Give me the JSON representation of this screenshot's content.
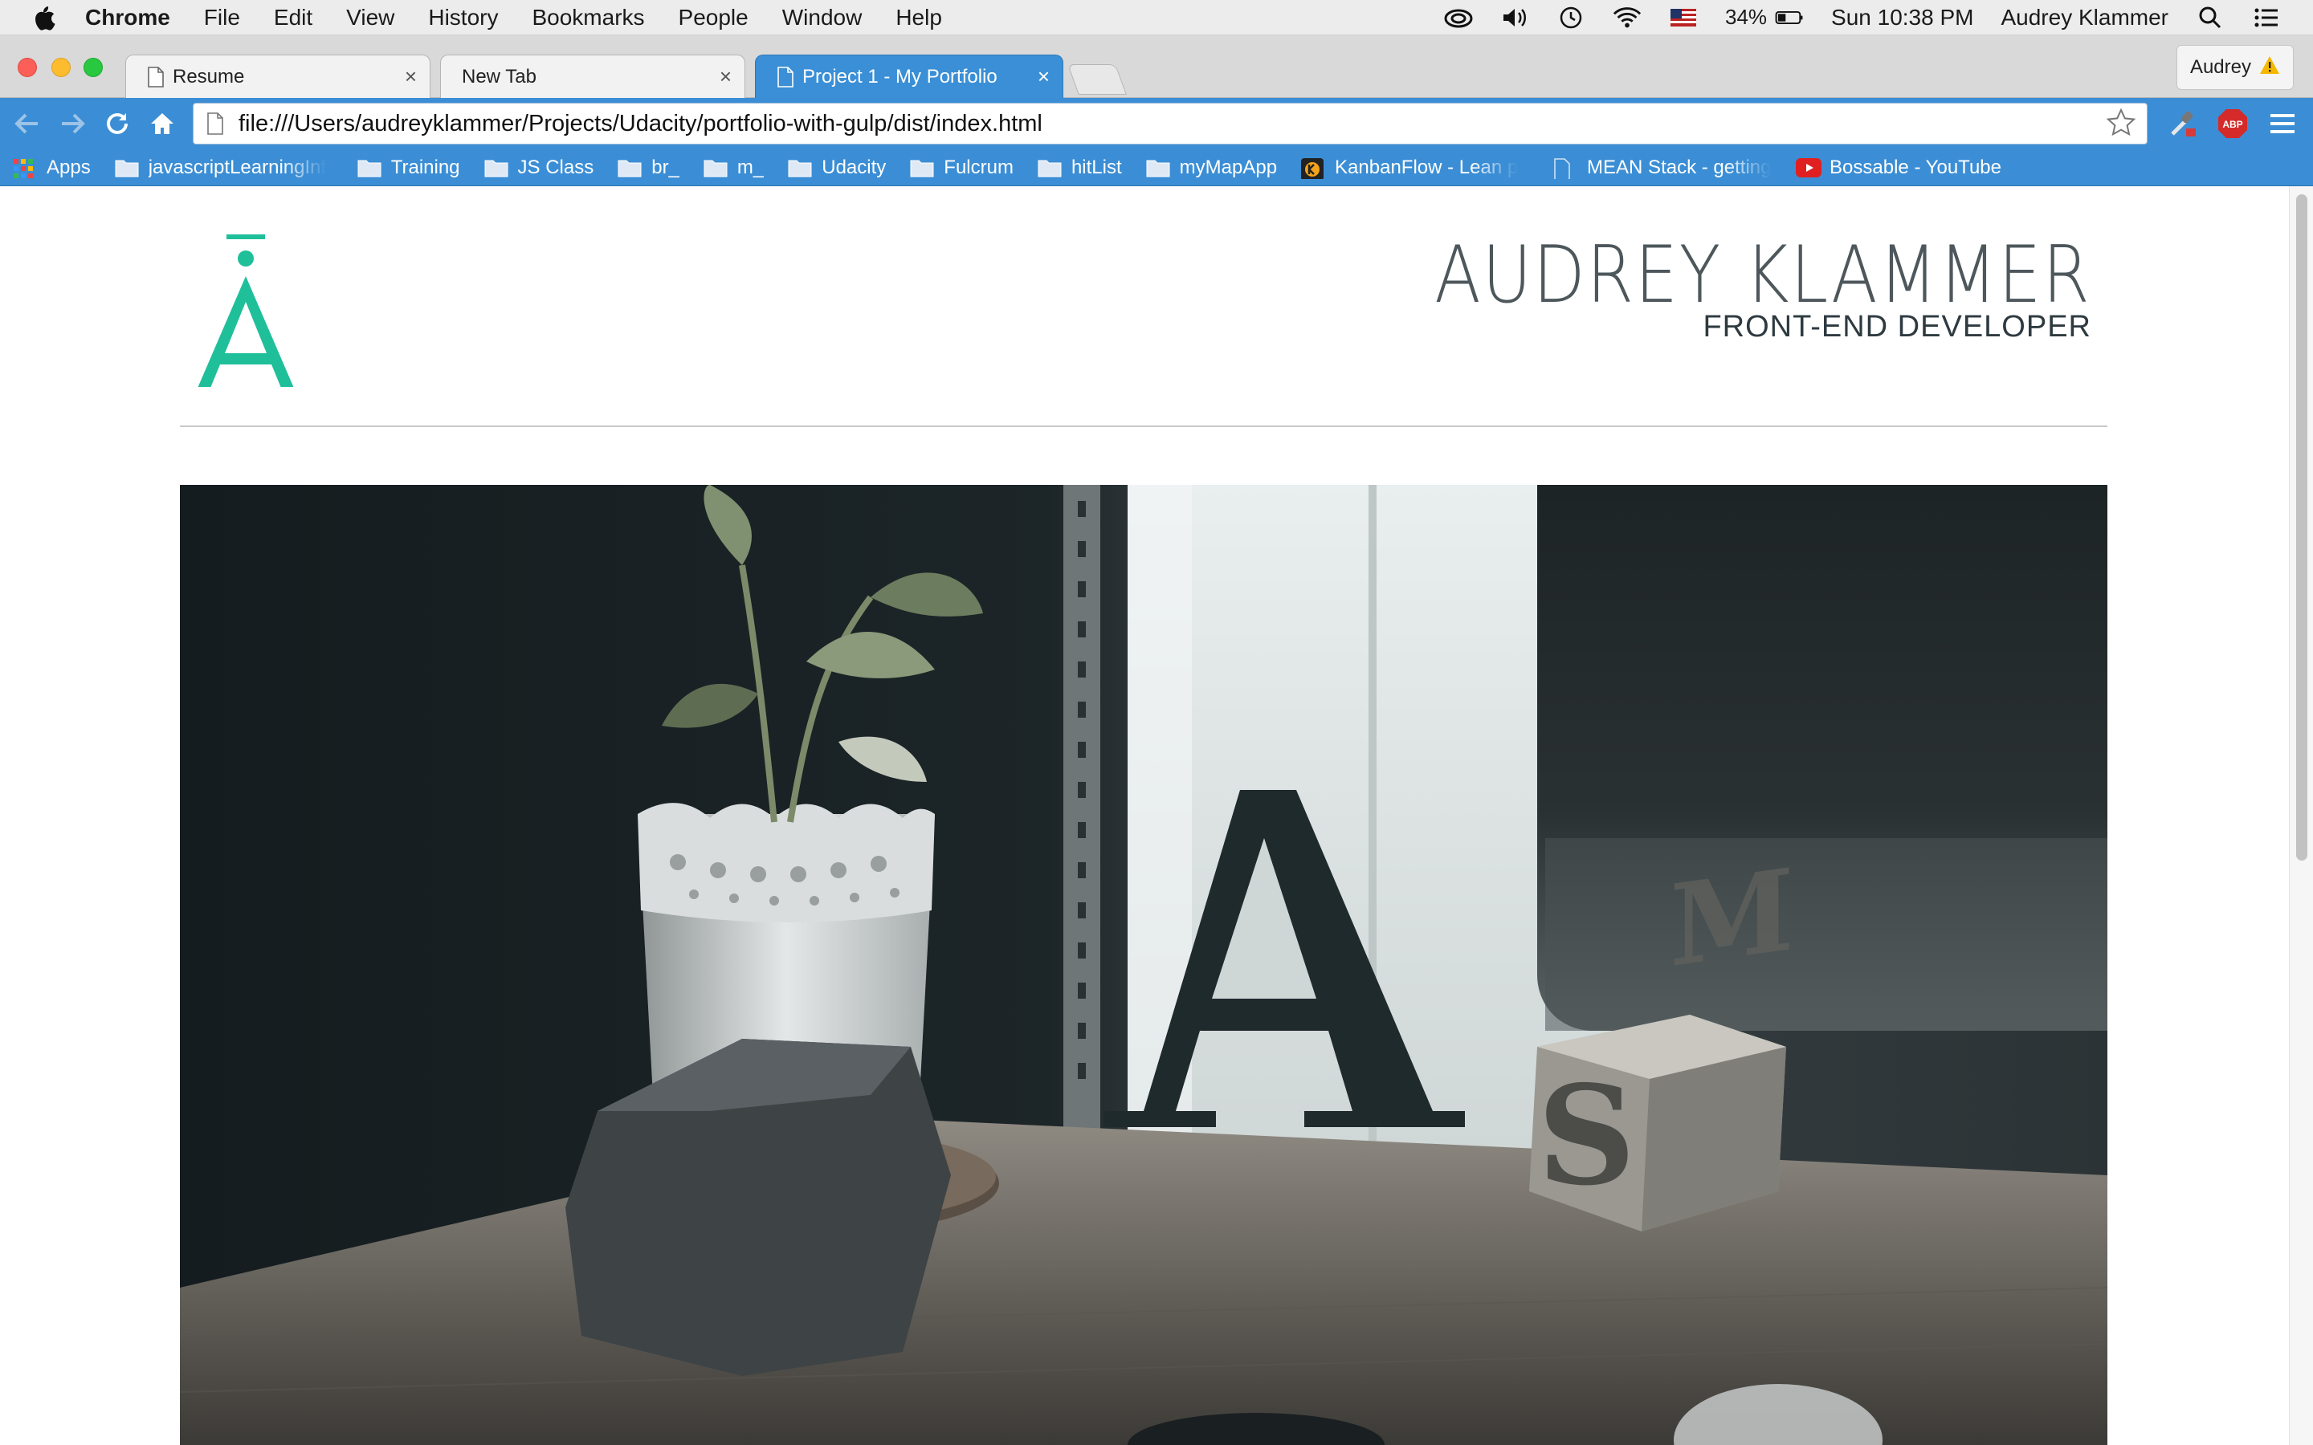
{
  "menubar": {
    "app_name": "Chrome",
    "menus": [
      "File",
      "Edit",
      "View",
      "History",
      "Bookmarks",
      "People",
      "Window",
      "Help"
    ],
    "battery": "34%",
    "clock": "Sun 10:38 PM",
    "user": "Audrey Klammer"
  },
  "tabs": [
    {
      "label": "Resume",
      "active": false
    },
    {
      "label": "New Tab",
      "active": false
    },
    {
      "label": "Project 1 - My Portfolio",
      "active": true
    }
  ],
  "profile": {
    "label": "Audrey"
  },
  "address_bar": {
    "url": "file:///Users/audreyklammer/Projects/Udacity/portfolio-with-gulp/dist/index.html"
  },
  "bookmarks": [
    {
      "label": "Apps",
      "icon": "apps-grid-icon"
    },
    {
      "label": "javascriptLearningInf",
      "icon": "folder-icon"
    },
    {
      "label": "Training",
      "icon": "folder-icon"
    },
    {
      "label": "JS Class",
      "icon": "folder-icon"
    },
    {
      "label": "br_",
      "icon": "folder-icon"
    },
    {
      "label": "m_",
      "icon": "folder-icon"
    },
    {
      "label": "Udacity",
      "icon": "folder-icon"
    },
    {
      "label": "Fulcrum",
      "icon": "folder-icon"
    },
    {
      "label": "hitList",
      "icon": "folder-icon"
    },
    {
      "label": "myMapApp",
      "icon": "folder-icon"
    },
    {
      "label": "KanbanFlow - Lean p",
      "icon": "kanbanflow-icon"
    },
    {
      "label": "MEAN Stack - getting",
      "icon": "page-icon"
    },
    {
      "label": "Bossable - YouTube",
      "icon": "youtube-icon"
    }
  ],
  "page": {
    "logo_letter": "Ā",
    "name": "AUDREY KLAMMER",
    "role": "FRONT-END DEVELOPER",
    "accent_color": "#1fbf9a",
    "hero_letters": [
      "A",
      "S",
      "M"
    ]
  }
}
